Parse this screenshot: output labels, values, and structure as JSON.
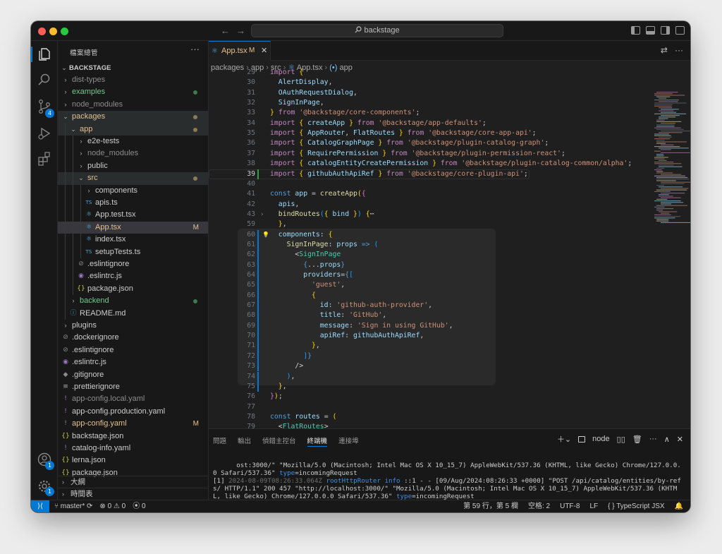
{
  "titlebar": {
    "search_text": "backstage"
  },
  "activity": {
    "explorer_icon": "files-icon",
    "search_icon": "search-icon",
    "scm_badge": "4",
    "account_badge": "1",
    "settings_badge": "1"
  },
  "sidebar": {
    "title": "檔案總管",
    "root": "BACKSTAGE",
    "items": [
      {
        "label": "dist-types",
        "kind": "folder",
        "open": false,
        "depth": 1,
        "color": "#8c8c8c"
      },
      {
        "label": "examples",
        "kind": "folder",
        "open": false,
        "depth": 1,
        "color": "#73c991",
        "dot": "#3e7a4e"
      },
      {
        "label": "node_modules",
        "kind": "folder",
        "open": false,
        "depth": 1,
        "color": "#8c8c8c"
      },
      {
        "label": "packages",
        "kind": "folder",
        "open": true,
        "depth": 1,
        "color": "#e2c08d",
        "dot": "#8d7a55"
      },
      {
        "label": "app",
        "kind": "folder",
        "open": true,
        "depth": 2,
        "color": "#e2c08d",
        "dot": "#8d7a55"
      },
      {
        "label": "e2e-tests",
        "kind": "folder",
        "open": false,
        "depth": 3,
        "color": "#cccccc"
      },
      {
        "label": "node_modules",
        "kind": "folder",
        "open": false,
        "depth": 3,
        "color": "#8c8c8c"
      },
      {
        "label": "public",
        "kind": "folder",
        "open": false,
        "depth": 3,
        "color": "#cccccc"
      },
      {
        "label": "src",
        "kind": "folder",
        "open": true,
        "depth": 3,
        "color": "#e2c08d",
        "dot": "#8d7a55"
      },
      {
        "label": "components",
        "kind": "folder",
        "open": false,
        "depth": 4,
        "color": "#cccccc"
      },
      {
        "label": "apis.ts",
        "kind": "ts",
        "depth": 4,
        "color": "#cccccc"
      },
      {
        "label": "App.test.tsx",
        "kind": "tsx",
        "depth": 4,
        "color": "#cccccc"
      },
      {
        "label": "App.tsx",
        "kind": "tsx",
        "depth": 4,
        "color": "#e2c08d",
        "status": "M",
        "selected": true
      },
      {
        "label": "index.tsx",
        "kind": "tsx",
        "depth": 4,
        "color": "#cccccc"
      },
      {
        "label": "setupTests.ts",
        "kind": "ts",
        "depth": 4,
        "color": "#cccccc"
      },
      {
        "label": ".eslintignore",
        "kind": "ignore",
        "depth": 3,
        "color": "#cccccc"
      },
      {
        "label": ".eslintrc.js",
        "kind": "eslint",
        "depth": 3,
        "color": "#cccccc"
      },
      {
        "label": "package.json",
        "kind": "json",
        "depth": 3,
        "color": "#cccccc"
      },
      {
        "label": "backend",
        "kind": "folder",
        "open": false,
        "depth": 2,
        "color": "#73c991",
        "dot": "#3e7a4e"
      },
      {
        "label": "README.md",
        "kind": "md",
        "depth": 2,
        "color": "#cccccc"
      },
      {
        "label": "plugins",
        "kind": "folder",
        "open": false,
        "depth": 1,
        "color": "#cccccc"
      },
      {
        "label": ".dockerignore",
        "kind": "docker",
        "depth": 1,
        "color": "#cccccc"
      },
      {
        "label": ".eslintignore",
        "kind": "ignore",
        "depth": 1,
        "color": "#cccccc"
      },
      {
        "label": ".eslintrc.js",
        "kind": "eslint",
        "depth": 1,
        "color": "#cccccc"
      },
      {
        "label": ".gitignore",
        "kind": "git",
        "depth": 1,
        "color": "#cccccc"
      },
      {
        "label": ".prettierignore",
        "kind": "lines",
        "depth": 1,
        "color": "#cccccc"
      },
      {
        "label": "app-config.local.yaml",
        "kind": "yaml",
        "depth": 1,
        "color": "#8c8c8c"
      },
      {
        "label": "app-config.production.yaml",
        "kind": "yaml",
        "depth": 1,
        "color": "#cccccc"
      },
      {
        "label": "app-config.yaml",
        "kind": "yaml",
        "depth": 1,
        "color": "#e2c08d",
        "status": "M"
      },
      {
        "label": "backstage.json",
        "kind": "json",
        "depth": 1,
        "color": "#cccccc"
      },
      {
        "label": "catalog-info.yaml",
        "kind": "yaml",
        "depth": 1,
        "color": "#cccccc"
      },
      {
        "label": "lerna.json",
        "kind": "json",
        "depth": 1,
        "color": "#cccccc"
      },
      {
        "label": "package.json",
        "kind": "json",
        "depth": 1,
        "color": "#cccccc"
      }
    ],
    "outline_label": "大綱",
    "timeline_label": "時間表"
  },
  "editor": {
    "tab": {
      "name": "App.tsx",
      "status": "M"
    },
    "breadcrumb": [
      "packages",
      "app",
      "src",
      "App.tsx",
      "app"
    ],
    "lines": [
      {
        "n": "29",
        "html": "<span class=\"kw\">import</span> <span class=\"brk\">{</span>"
      },
      {
        "n": "30",
        "html": "  <span class=\"var\">AlertDisplay</span>,"
      },
      {
        "n": "31",
        "html": "  <span class=\"var\">OAuthRequestDialog</span>,"
      },
      {
        "n": "32",
        "html": "  <span class=\"var\">SignInPage</span>,"
      },
      {
        "n": "33",
        "html": "<span class=\"brk\">}</span> <span class=\"kw\">from</span> <span class=\"str\">'@backstage/core-components'</span>;"
      },
      {
        "n": "34",
        "html": "<span class=\"kw\">import</span> <span class=\"brk\">{</span> <span class=\"var\">createApp</span> <span class=\"brk\">}</span> <span class=\"kw\">from</span> <span class=\"str\">'@backstage/app-defaults'</span>;"
      },
      {
        "n": "35",
        "html": "<span class=\"kw\">import</span> <span class=\"brk\">{</span> <span class=\"var\">AppRouter</span>, <span class=\"var\">FlatRoutes</span> <span class=\"brk\">}</span> <span class=\"kw\">from</span> <span class=\"str\">'@backstage/core-app-api'</span>;"
      },
      {
        "n": "36",
        "html": "<span class=\"kw\">import</span> <span class=\"brk\">{</span> <span class=\"var\">CatalogGraphPage</span> <span class=\"brk\">}</span> <span class=\"kw\">from</span> <span class=\"str\">'@backstage/plugin-catalog-graph'</span>;"
      },
      {
        "n": "37",
        "html": "<span class=\"kw\">import</span> <span class=\"brk\">{</span> <span class=\"var\">RequirePermission</span> <span class=\"brk\">}</span> <span class=\"kw\">from</span> <span class=\"str\">'@backstage/plugin-permission-react'</span>;"
      },
      {
        "n": "38",
        "html": "<span class=\"kw\">import</span> <span class=\"brk\">{</span> <span class=\"var\">catalogEntityCreatePermission</span> <span class=\"brk\">}</span> <span class=\"kw\">from</span> <span class=\"str\">'@backstage/plugin-catalog-common/alpha'</span>;"
      },
      {
        "n": "39",
        "html": "<span class=\"kw\">import</span> <span class=\"brk\">{</span> <span class=\"var\">githubAuthApiRef</span> <span class=\"brk\">}</span> <span class=\"kw\">from</span> <span class=\"str\">'@backstage/core-plugin-api'</span>;",
        "cur": true
      },
      {
        "n": "40",
        "html": ""
      },
      {
        "n": "41",
        "html": "<span class=\"kw2\">const</span> <span class=\"var\">app</span> = <span class=\"fn\">createApp</span><span class=\"brk\">(</span><span class=\"punc\">{</span>"
      },
      {
        "n": "42",
        "html": "  <span class=\"var\">apis</span>,"
      },
      {
        "n": "43",
        "html": "  <span class=\"fn\">bindRoutes</span><span class=\"brk2\">(</span><span class=\"brk\">{</span> <span class=\"var\">bind</span> <span class=\"brk\">}</span><span class=\"brk2\">)</span> <span class=\"brk\">{</span><span class=\"txt\">⋯</span>"
      },
      {
        "n": "59",
        "html": "  <span class=\"brk\">}</span>,"
      },
      {
        "n": "60",
        "html": "  <span class=\"var\">components</span>: <span class=\"brk\">{</span>"
      },
      {
        "n": "61",
        "html": "    <span class=\"fn\">SignInPage</span>: <span class=\"var\">props</span> <span class=\"kw2\">=&gt;</span> <span class=\"brk2\">(</span>"
      },
      {
        "n": "62",
        "html": "      <span class=\"txt\">&lt;</span><span class=\"tag\">SignInPage</span>"
      },
      {
        "n": "63",
        "html": "        <span class=\"kw2\">{</span>...<span class=\"var\">props</span><span class=\"kw2\">}</span>"
      },
      {
        "n": "64",
        "html": "        <span class=\"var\">providers</span>=<span class=\"kw2\">{</span><span class=\"brk2\">[</span>"
      },
      {
        "n": "65",
        "html": "          <span class=\"str\">'guest'</span>,"
      },
      {
        "n": "66",
        "html": "          <span class=\"brk\">{</span>"
      },
      {
        "n": "67",
        "html": "            <span class=\"var\">id</span>: <span class=\"str\">'github-auth-provider'</span>,"
      },
      {
        "n": "68",
        "html": "            <span class=\"var\">title</span>: <span class=\"str\">'GitHub'</span>,"
      },
      {
        "n": "69",
        "html": "            <span class=\"var\">message</span>: <span class=\"str\">'Sign in using GitHub'</span>,"
      },
      {
        "n": "70",
        "html": "            <span class=\"var\">apiRef</span>: <span class=\"var\">githubAuthApiRef</span>,"
      },
      {
        "n": "71",
        "html": "          <span class=\"brk\">}</span>,"
      },
      {
        "n": "72",
        "html": "        <span class=\"brk2\">]</span><span class=\"kw2\">}</span>"
      },
      {
        "n": "73",
        "html": "      <span class=\"txt\">/&gt;</span>"
      },
      {
        "n": "74",
        "html": "    <span class=\"brk2\">)</span>,"
      },
      {
        "n": "75",
        "html": "  <span class=\"brk\">}</span>,"
      },
      {
        "n": "76",
        "html": "<span class=\"punc\">}</span><span class=\"brk\">)</span>;"
      },
      {
        "n": "77",
        "html": ""
      },
      {
        "n": "78",
        "html": "<span class=\"kw2\">const</span> <span class=\"var\">routes</span> = <span class=\"brk\">(</span>"
      },
      {
        "n": "79",
        "html": "  <span class=\"txt\">&lt;</span><span class=\"tag\">FlatRoutes</span><span class=\"txt\">&gt;</span>"
      }
    ]
  },
  "panel": {
    "tabs": [
      "問題",
      "輸出",
      "偵錯主控台",
      "終端機",
      "連接埠"
    ],
    "active_tab": "終端機",
    "terminal_name": "node",
    "terminal_lines": [
      "ost:3000/\" \"Mozilla/5.0 (Macintosh; Intel Mac OS X 10_15_7) AppleWebKit/537.36 (KHTML, like Gecko) Chrome/127.0.0.0 Safari/537.36\"",
      "[1] ",
      "2024-08-09T08:26:33.064Z",
      "rootHttpRouter",
      "info",
      " ::1 - - [09/Aug/2024:08:26:33 +0000] \"POST /api/catalog/entities/by-refs/ HTTP/1.1\" 200 457 \"http://localhost:3000/\" \"Mozilla/5.0 (Macintosh; Intel Mac OS X 10_15_7) AppleWebKit/537.36 (KHTML, like Gecko) Chrome/127.0.0.0 Safari/537.36\" ",
      "type",
      "=incomingRequest"
    ]
  },
  "status": {
    "branch": "master*",
    "errors": "0",
    "warnings": "0",
    "ports": "0",
    "position": "第 59 行，第 5 欄",
    "spaces": "空格: 2",
    "encoding": "UTF-8",
    "eol": "LF",
    "language": "TypeScript JSX"
  }
}
